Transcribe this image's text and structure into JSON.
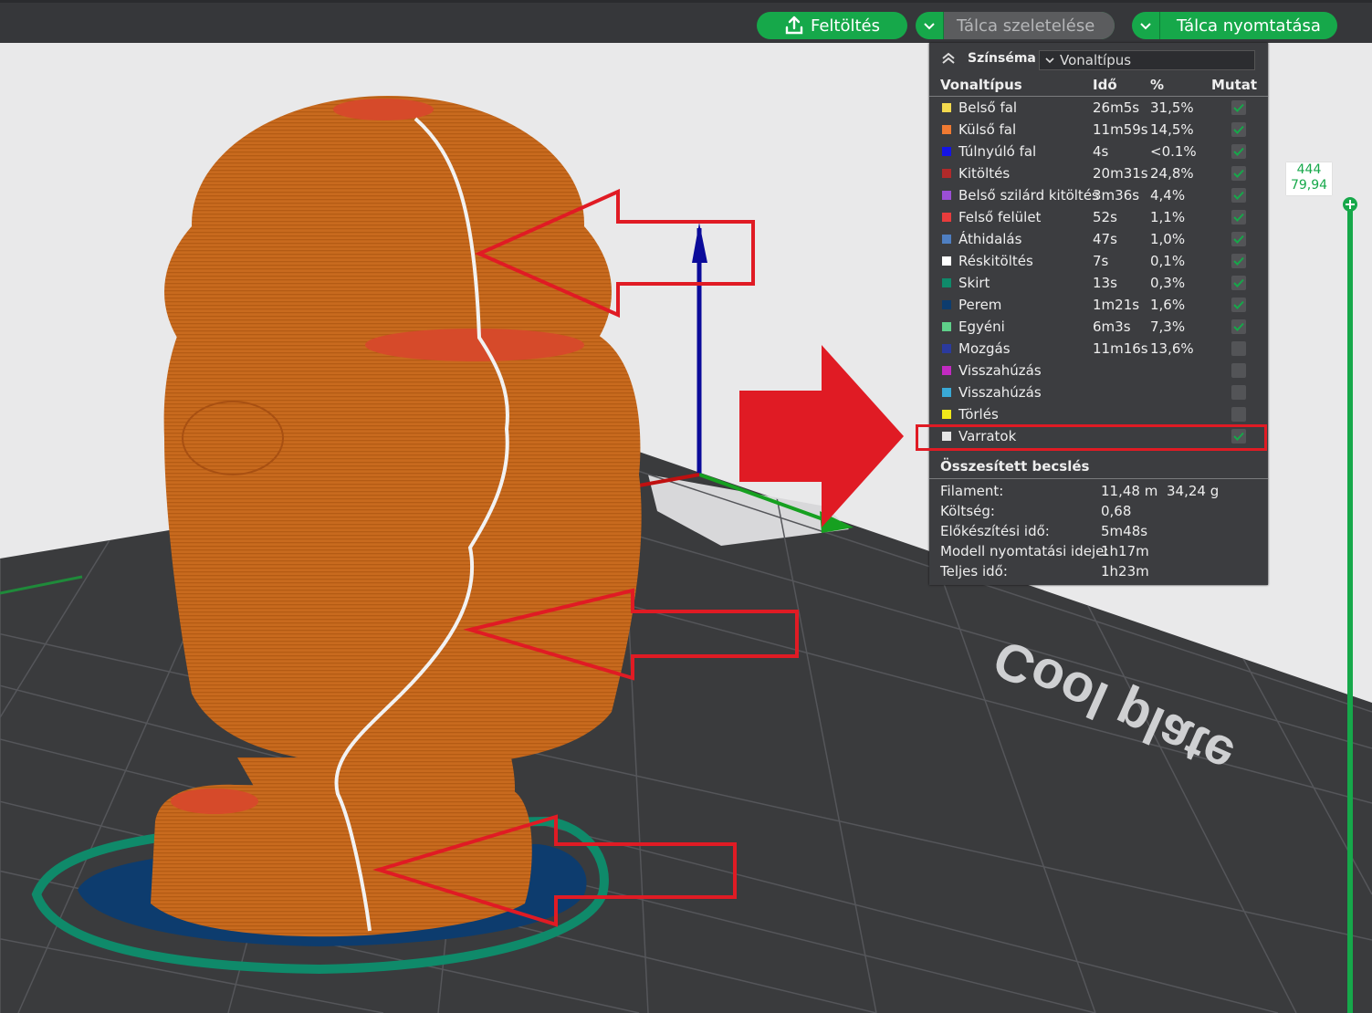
{
  "toolbar": {
    "upload_label": "Feltöltés",
    "slice_label": "Tálca szeletelése",
    "print_label": "Tálca nyomtatása",
    "accent": "#16a84a"
  },
  "legend": {
    "title": "Színséma",
    "scheme_value": "Vonaltípus",
    "columns": {
      "type": "Vonaltípus",
      "time": "Idő",
      "percent": "%",
      "show": "Mutat"
    },
    "rows": [
      {
        "name": "Belső fal",
        "time": "26m5s",
        "percent": "31,5%",
        "color": "#f3d94e",
        "shown": true
      },
      {
        "name": "Külső fal",
        "time": "11m59s",
        "percent": "14,5%",
        "color": "#f07a32",
        "shown": true
      },
      {
        "name": "Túlnyúló fal",
        "time": "4s",
        "percent": "<0.1%",
        "color": "#1414e6",
        "shown": true
      },
      {
        "name": "Kitöltés",
        "time": "20m31s",
        "percent": "24,8%",
        "color": "#b22a2a",
        "shown": true
      },
      {
        "name": "Belső szilárd kitöltés",
        "time": "3m36s",
        "percent": "4,4%",
        "color": "#9b4fd6",
        "shown": true
      },
      {
        "name": "Felső felület",
        "time": "52s",
        "percent": "1,1%",
        "color": "#e83c3c",
        "shown": true
      },
      {
        "name": "Áthidalás",
        "time": "47s",
        "percent": "1,0%",
        "color": "#4f7fc2",
        "shown": true
      },
      {
        "name": "Réskitöltés",
        "time": "7s",
        "percent": "0,1%",
        "color": "#ffffff",
        "shown": true
      },
      {
        "name": "Skirt",
        "time": "13s",
        "percent": "0,3%",
        "color": "#0f8a6a",
        "shown": true
      },
      {
        "name": "Perem",
        "time": "1m21s",
        "percent": "1,6%",
        "color": "#0d3c6e",
        "shown": true
      },
      {
        "name": "Egyéni",
        "time": "6m3s",
        "percent": "7,3%",
        "color": "#5fd08a",
        "shown": true
      },
      {
        "name": "Mozgás",
        "time": "11m16s",
        "percent": "13,6%",
        "color": "#2b3a9e",
        "shown": false
      },
      {
        "name": "Visszahúzás",
        "time": "",
        "percent": "",
        "color": "#c22ac2",
        "shown": false
      },
      {
        "name": "Visszahúzás",
        "time": "",
        "percent": "",
        "color": "#39a9d6",
        "shown": false
      },
      {
        "name": "Törlés",
        "time": "",
        "percent": "",
        "color": "#f0e81a",
        "shown": false
      },
      {
        "name": "Varratok",
        "time": "",
        "percent": "",
        "color": "#e6e6e6",
        "shown": true
      }
    ],
    "summary_title": "Összesített becslés",
    "summary": [
      {
        "label": "Filament:",
        "value": "11,48 m",
        "extra": "34,24 g"
      },
      {
        "label": "Költség:",
        "value": "0,68",
        "extra": ""
      },
      {
        "label": "Előkészítési idő:",
        "value": "5m48s",
        "extra": ""
      },
      {
        "label": "Modell nyomtatási ideje:",
        "value": "1h17m",
        "extra": ""
      },
      {
        "label": "Teljes idő:",
        "value": "1h23m",
        "extra": ""
      }
    ]
  },
  "slider": {
    "layer": "444",
    "height": "79,94"
  },
  "plate_text": "Cool plate"
}
